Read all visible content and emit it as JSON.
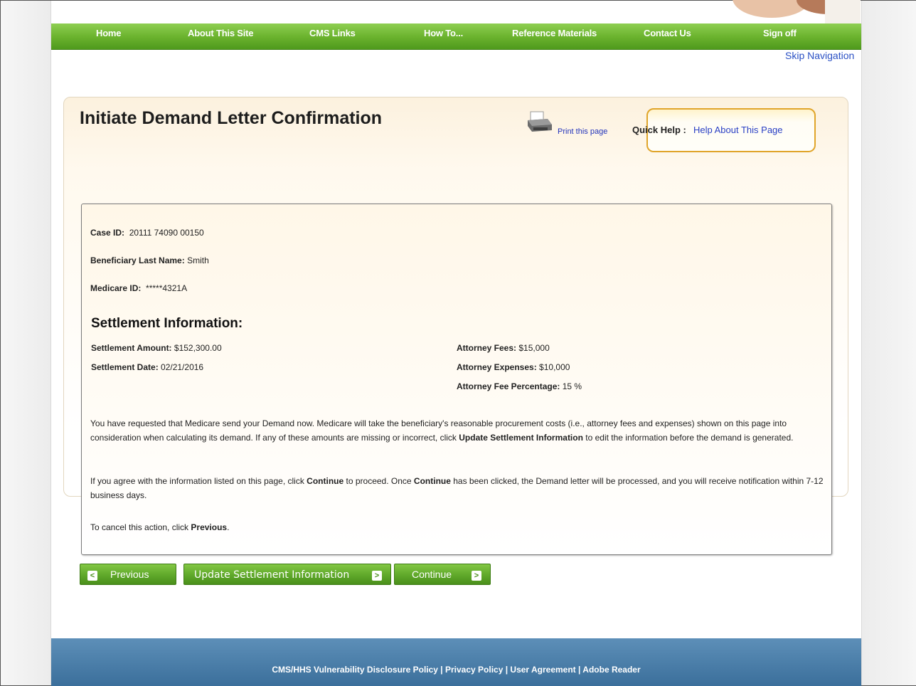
{
  "nav": {
    "items": [
      "Home",
      "About This Site",
      "CMS Links",
      "How To...",
      "Reference Materials",
      "Contact Us",
      "Sign off"
    ]
  },
  "skip_navigation": "Skip Navigation",
  "page": {
    "title": "Initiate Demand Letter Confirmation",
    "print_link": "Print this page",
    "quick_help_label": "Quick Help :",
    "quick_help_link": "Help About This Page"
  },
  "case": {
    "case_id_label": "Case ID:",
    "case_id": "20111 74090 00150",
    "last_name_label": "Beneficiary Last Name:",
    "last_name": "Smith",
    "medicare_id_label": "Medicare ID:",
    "medicare_id": "*****4321A"
  },
  "settlement": {
    "heading": "Settlement Information:",
    "amount_label": "Settlement Amount:",
    "amount": "$152,300.00",
    "date_label": "Settlement Date:",
    "date": "02/21/2016",
    "fees_label": "Attorney Fees:",
    "fees": "$15,000",
    "expenses_label": "Attorney Expenses:",
    "expenses": "$10,000",
    "percentage_label": "Attorney Fee Percentage:",
    "percentage": "15 %"
  },
  "text": {
    "p1_a": "You have requested that Medicare send your Demand now. Medicare will take the beneficiary's reasonable procurement costs (i.e., attorney fees and expenses) shown on this page into consideration when calculating its demand. If any of these amounts are missing or incorrect, click ",
    "p1_b": "Update Settlement Information",
    "p1_c": " to edit the information before the demand is generated.",
    "p2_a": "If you agree with the information listed on this page, click ",
    "p2_b": "Continue",
    "p2_c": " to proceed. Once ",
    "p2_d": "Continue",
    "p2_e": " has been clicked, the Demand letter will be processed, and you will receive notification within 7-12 business days.",
    "p3_a": "To cancel this action, click ",
    "p3_b": "Previous",
    "p3_c": "."
  },
  "buttons": {
    "previous": "Previous",
    "update": "Update Settlement Information",
    "continue": "Continue"
  },
  "footer": {
    "links": [
      "CMS/HHS Vulnerability Disclosure Policy",
      "Privacy Policy",
      "User Agreement",
      "Adobe Reader"
    ],
    "separator": " | "
  },
  "colors": {
    "nav_green": "#6cb42f",
    "button_green": "#5fa82a",
    "footer_blue": "#3b6f9b",
    "link_blue": "#2a40c4",
    "help_border": "#e0a52a"
  },
  "icons": [
    "printer-icon",
    "chevron-left-icon",
    "chevron-right-icon"
  ]
}
